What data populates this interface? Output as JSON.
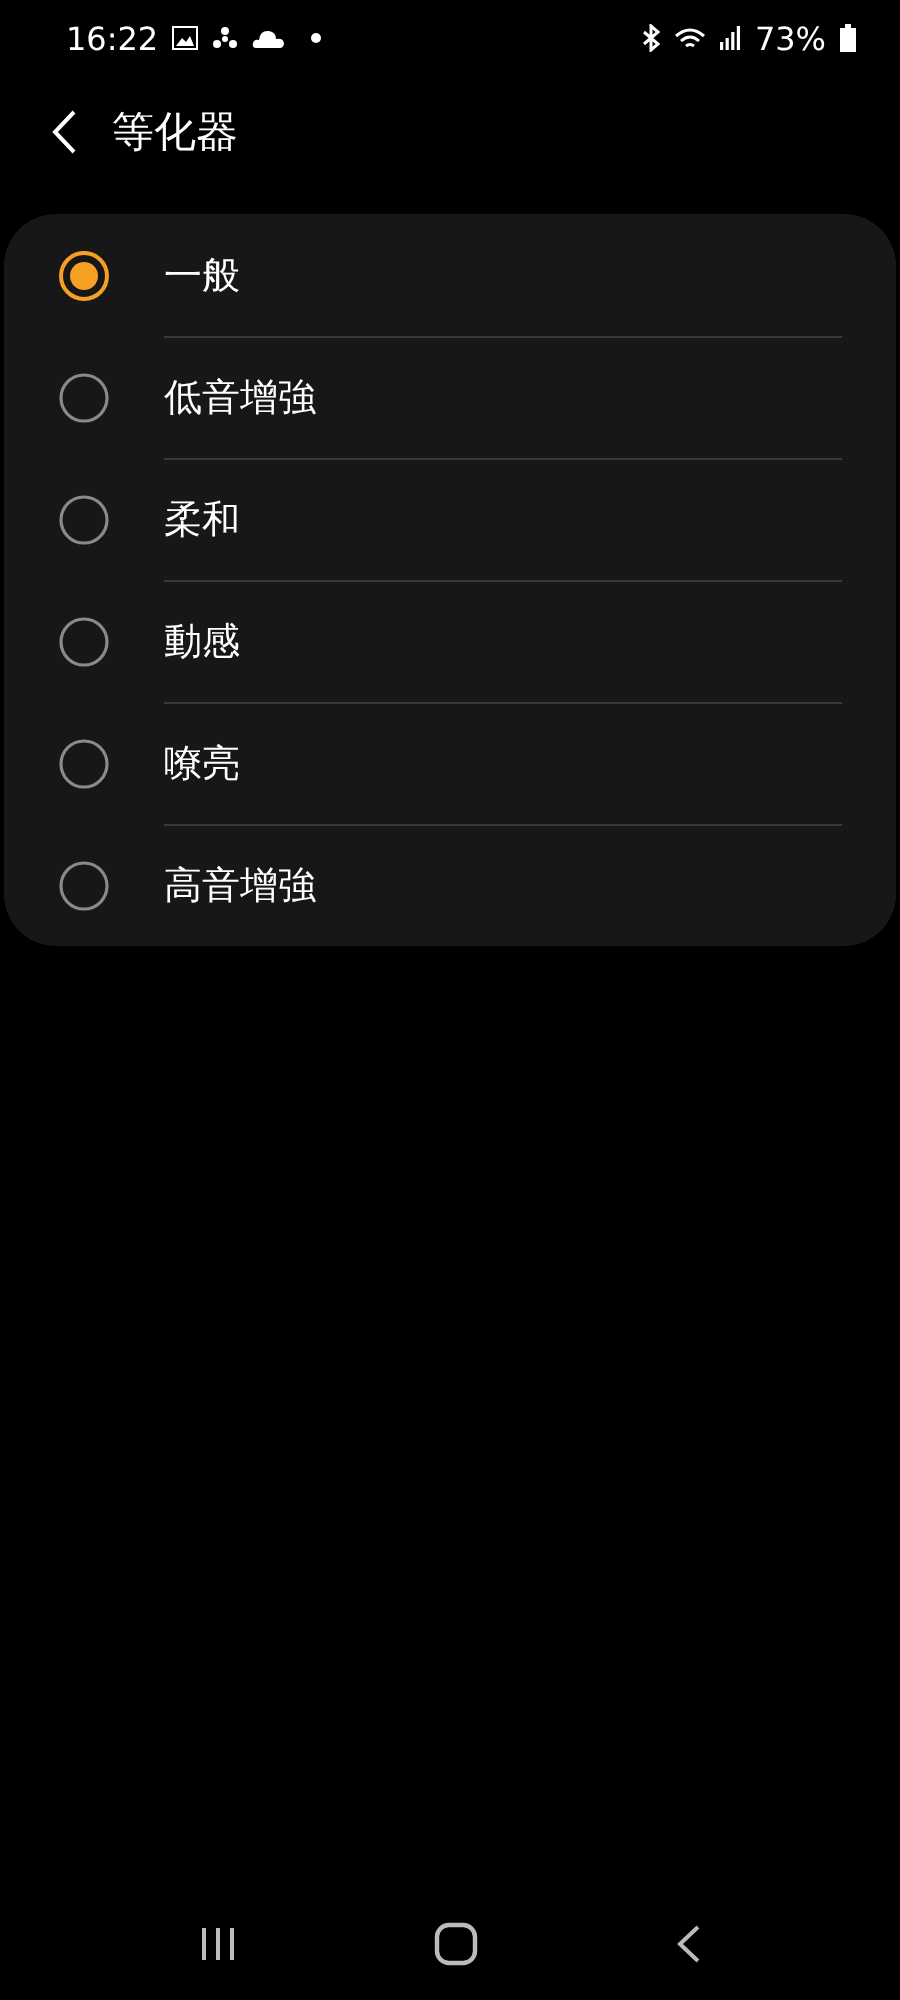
{
  "status_bar": {
    "time": "16:22",
    "battery": "73%"
  },
  "header": {
    "title": "等化器"
  },
  "options": [
    {
      "label": "一般",
      "selected": true
    },
    {
      "label": "低音增強",
      "selected": false
    },
    {
      "label": "柔和",
      "selected": false
    },
    {
      "label": "動感",
      "selected": false
    },
    {
      "label": "嘹亮",
      "selected": false
    },
    {
      "label": "高音增強",
      "selected": false
    }
  ]
}
